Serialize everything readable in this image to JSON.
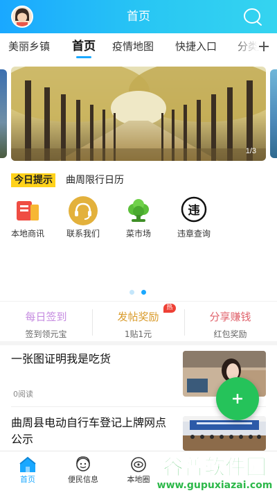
{
  "header": {
    "title": "首页"
  },
  "tabs": [
    {
      "label": "美丽乡镇",
      "active": false
    },
    {
      "label": "首页",
      "active": true
    },
    {
      "label": "疫情地图",
      "active": false
    },
    {
      "label": "快捷入口",
      "active": false
    },
    {
      "label": "分类",
      "active": false
    }
  ],
  "banner": {
    "counter": "1/3"
  },
  "tip": {
    "badge": "今日提示",
    "text": "曲周限行日历"
  },
  "quick_links": [
    {
      "label": "本地商讯",
      "icon": "bookmark-icon"
    },
    {
      "label": "联系我们",
      "icon": "headset-icon"
    },
    {
      "label": "菜市场",
      "icon": "vegetable-icon"
    },
    {
      "label": "违章查询",
      "icon": "traffic-violation-icon"
    }
  ],
  "carousel_dots": {
    "count": 2,
    "active": 1
  },
  "promos": [
    {
      "title": "每日签到",
      "subtitle": "签到领元宝",
      "color": "#c58be0"
    },
    {
      "title": "发帖奖励",
      "subtitle": "1贴1元",
      "color": "#d99b2b",
      "badge": "热"
    },
    {
      "title": "分享赚钱",
      "subtitle": "红包奖励",
      "color": "#e0626b"
    }
  ],
  "news": [
    {
      "title": "一张图证明我是吃货",
      "meta": "0阅读"
    },
    {
      "title": "曲周县电动自行车登记上牌网点公示",
      "meta": ""
    }
  ],
  "fab": {
    "icon": "plus-icon"
  },
  "bottom_nav": [
    {
      "label": "首页",
      "icon": "home-icon",
      "active": true
    },
    {
      "label": "便民信息",
      "icon": "service-icon",
      "active": false
    },
    {
      "label": "本地圈",
      "icon": "circle-icon",
      "active": false
    }
  ],
  "watermark": {
    "brand": "谷普软件园",
    "url": "www.gupuxiazai.com"
  },
  "colors": {
    "accent": "#1aa8ff",
    "fab": "#25c35a",
    "badge": "#ffd21a"
  }
}
